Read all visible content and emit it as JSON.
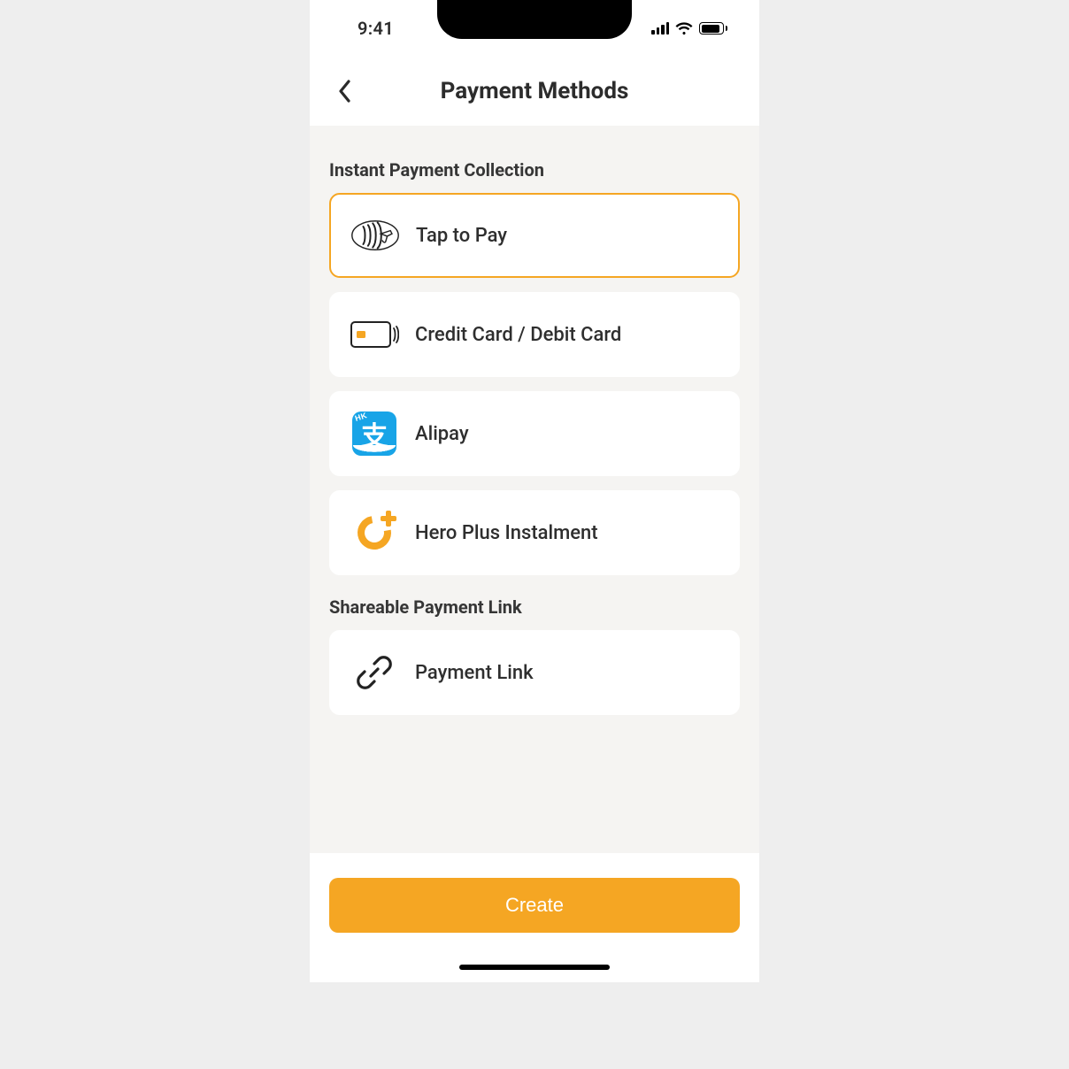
{
  "status_bar": {
    "time": "9:41"
  },
  "header": {
    "title": "Payment Methods"
  },
  "sections": {
    "instant": {
      "title": "Instant Payment Collection",
      "options": {
        "tap_to_pay": {
          "label": "Tap to Pay",
          "selected": true,
          "icon": "contactless-icon"
        },
        "card": {
          "label": "Credit Card / Debit Card",
          "selected": false,
          "icon": "card-icon"
        },
        "alipay": {
          "label": "Alipay",
          "selected": false,
          "icon": "alipay-icon",
          "glyph": "支",
          "hk": "HK"
        },
        "hero": {
          "label": "Hero Plus Instalment",
          "selected": false,
          "icon": "hero-plus-icon"
        }
      }
    },
    "shareable": {
      "title": "Shareable Payment Link",
      "options": {
        "link": {
          "label": "Payment Link",
          "selected": false,
          "icon": "link-icon"
        }
      }
    }
  },
  "footer": {
    "create_label": "Create"
  },
  "colors": {
    "accent": "#f5a623",
    "alipay_blue": "#18a4e7"
  }
}
